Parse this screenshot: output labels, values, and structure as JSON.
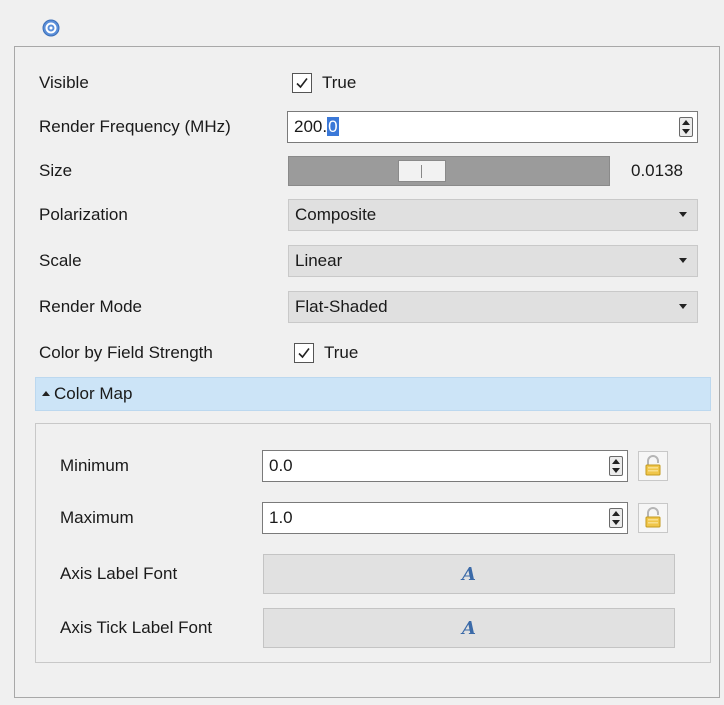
{
  "properties": {
    "visible": {
      "label": "Visible",
      "checked": true,
      "value_text": "True"
    },
    "render_frequency": {
      "label": "Render Frequency (MHz)",
      "value_prefix": "200.",
      "value_selected": "0"
    },
    "size": {
      "label": "Size",
      "slider_fraction": 0.4,
      "value": "0.0138"
    },
    "polarization": {
      "label": "Polarization",
      "value": "Composite"
    },
    "scale": {
      "label": "Scale",
      "value": "Linear"
    },
    "render_mode": {
      "label": "Render Mode",
      "value": "Flat-Shaded"
    },
    "color_by_field_strength": {
      "label": "Color by Field Strength",
      "checked": true,
      "value_text": "True"
    }
  },
  "color_map": {
    "title": "Color Map",
    "expanded": true,
    "minimum": {
      "label": "Minimum",
      "value": "0.0"
    },
    "maximum": {
      "label": "Maximum",
      "value": "1.0"
    },
    "axis_label_font": {
      "label": "Axis Label Font"
    },
    "axis_tick_label_font": {
      "label": "Axis Tick Label Font"
    }
  },
  "icons": {
    "help": "help-icon",
    "spin": "spin-arrows-icon",
    "lock": "lock-icon",
    "font": "font-icon",
    "dropdown": "chevron-down-icon",
    "collapse": "chevron-up-icon"
  },
  "colors": {
    "section_header_bg": "#cce4f7",
    "selection_highlight": "#3a78d8",
    "slider_track": "#9b9b9b",
    "font_glyph": "#3b6aa8"
  }
}
